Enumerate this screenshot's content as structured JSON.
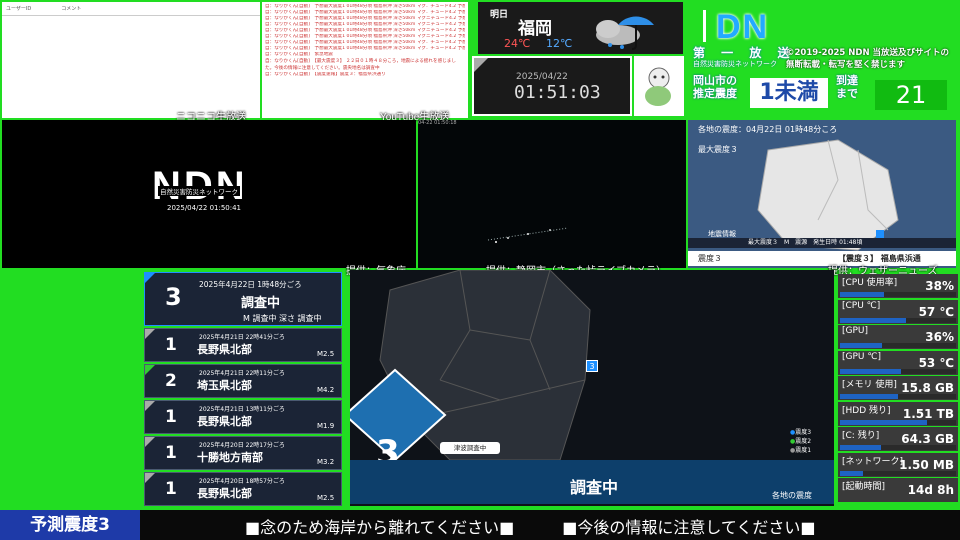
{
  "niconico": {
    "col_user": "ユーザーID",
    "col_comment": "コメント",
    "label": "ニコニコ生放送"
  },
  "youtube": {
    "label": "YouTube生放送",
    "lines": [
      "自：なりかくん[自動]　予想最大震度1 01時48分頃 福島県沖 深さ50km マグ．チュード4.2 予想震度3",
      "自：なりかくん[自動]　予想最大震度1 01時48分頃 福島県沖 深さ50km マグニチュード4.2 予想震度3",
      "自：なりかくん[自動]　予想最大震度1 01時48分頃 福島県沖 深さ50km マグニチュード4.2 予想震度3",
      "自：なりかくん[自動]　予想最大震度1 01時48分頃 福島県沖 深さ50km マグ．チュード4.2 予想震度3",
      "自：なりかくん[自動]　緊急地震",
      "自：なりかくん[自動]　【最大震度３】 ２２日０１時４８分ころ，地震による揺れを感じました。今後の情報に注意してください。震央地名は調査中",
      "自：なりかくん[自動]　【震度速報】震度３：福島県浜通り"
    ]
  },
  "weather": {
    "day": "明日",
    "city": "福岡",
    "high": "24℃",
    "low": "12℃"
  },
  "clock": {
    "date": "2025/04/22",
    "time": "01:51:03"
  },
  "logo": {
    "dn": "DN",
    "title": "第 一 放 送",
    "subtitle": "自然災害防災ネットワーク",
    "copyright_1": "©2019-2025 NDN 当放送及びサイトの",
    "copyright_2": "無断転載・転写を堅く禁じます"
  },
  "estimate": {
    "label_1": "岡山市の",
    "label_2": "推定震度",
    "value": "1未満",
    "arrive_label_1": "到達",
    "arrive_label_2": "まで",
    "arrive_value": "21"
  },
  "video": {
    "ndn_logo": "NDN",
    "ndn_sub": "自然災害防災ネットワーク",
    "ndn_timestamp": "2025/04/22 01:50:41",
    "cam_timestamp": "04-22 01:50:18",
    "source_jma": "提供：気象庁",
    "source_cam": "提供：静岡市（さった峠ライブカメラ）",
    "source_wn": "提供：ウェザーニューズ"
  },
  "quake_panel": {
    "header": "各地の震度：04月22日 01時48分ころ",
    "max_intensity": "最大震度３",
    "info_title": "地震情報",
    "info_bar": "最大震度３　M　震源　発生日時 01:48頃",
    "intensity_label": "震度３",
    "region_label": "【震度３】 福島県浜通"
  },
  "quake_list": [
    {
      "intensity": "3",
      "datetime": "2025年4月22日 1時48分ごろ",
      "place": "調査中",
      "magnitude": "M 調査中 深さ 調査中",
      "tri_color": "#1e90ff"
    },
    {
      "intensity": "1",
      "datetime": "2025年4月21日 22時41分ごろ",
      "place": "長野県北部",
      "magnitude": "M2.5",
      "tri_color": "#aaaaaa"
    },
    {
      "intensity": "2",
      "datetime": "2025年4月21日 22時11分ごろ",
      "place": "埼玉県北部",
      "magnitude": "M4.2",
      "tri_color": "#33cc33"
    },
    {
      "intensity": "1",
      "datetime": "2025年4月21日 13時11分ごろ",
      "place": "長野県北部",
      "magnitude": "M1.9",
      "tri_color": "#aaaaaa"
    },
    {
      "intensity": "1",
      "datetime": "2025年4月20日 22時17分ごろ",
      "place": "十勝地方南部",
      "magnitude": "M3.2",
      "tri_color": "#aaaaaa"
    },
    {
      "intensity": "1",
      "datetime": "2025年4月20日 18時57分ごろ",
      "place": "長野県北部",
      "magnitude": "M2.5",
      "tri_color": "#aaaaaa"
    }
  ],
  "main_map": {
    "big_intensity": "3",
    "station_marker": "3",
    "tsunami": "津波調査中",
    "status": "調査中",
    "region": "各地の震度",
    "legend": [
      "震度3",
      "震度2",
      "震度1"
    ],
    "legend_colors": [
      "#1e90ff",
      "#33cc33",
      "#999999"
    ]
  },
  "stats": [
    {
      "label": "[CPU 使用率]",
      "value": "38%",
      "fill": 0.38
    },
    {
      "label": "[CPU ℃]",
      "value": "57 ℃",
      "fill": 0.57
    },
    {
      "label": "[GPU]",
      "value": "36%",
      "fill": 0.36
    },
    {
      "label": "[GPU ℃]",
      "value": "53 ℃",
      "fill": 0.53
    },
    {
      "label": "[メモリ 使用]",
      "value": "15.8 GB",
      "fill": 0.5
    },
    {
      "label": "[HDD 残り]",
      "value": "1.51 TB",
      "fill": 0.75
    },
    {
      "label": "[C: 残り]",
      "value": "64.3 GB",
      "fill": 0.35
    },
    {
      "label": "[ネットワーク]",
      "value": "1.50 MB",
      "fill": 0.2
    },
    {
      "label": "[起動時間]",
      "value": "14d 8h",
      "fill": 0
    }
  ],
  "ticker": {
    "badge": "予測震度3",
    "message": "■念のため海岸から離れてください■　　　■今後の情報に注意してください■"
  }
}
